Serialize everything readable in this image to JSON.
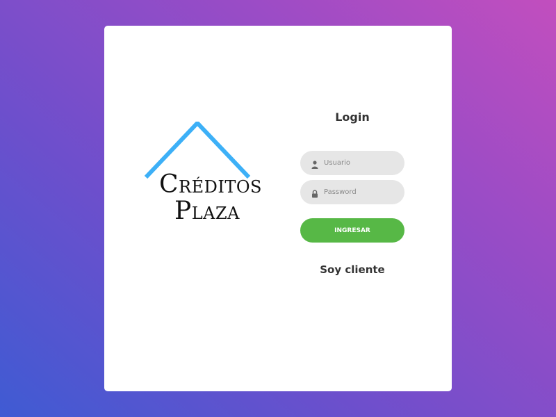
{
  "logo": {
    "line1_initial": "C",
    "line1_rest": "RÉDITOS",
    "line2_initial": "P",
    "line2_rest": "LAZA",
    "roof_color": "#3db0f7"
  },
  "login": {
    "title": "Login",
    "username_placeholder": "Usuario",
    "password_placeholder": "Password",
    "submit_label": "INGRESAR",
    "client_link": "Soy cliente"
  },
  "colors": {
    "background_gradient": [
      "#3f5bd3",
      "#c24ebe"
    ],
    "button": "#57b846",
    "input_bg": "#e6e6e6"
  },
  "icons": {
    "username": "user-icon",
    "password": "lock-icon"
  }
}
